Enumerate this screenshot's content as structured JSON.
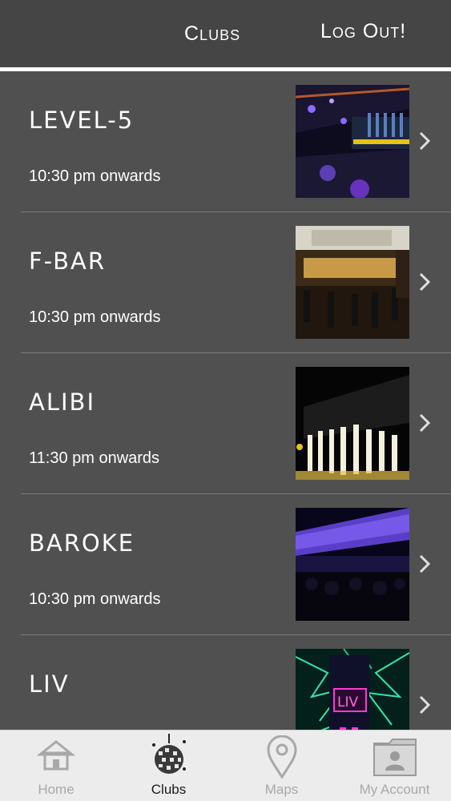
{
  "header": {
    "title": "Clubs",
    "logout_label": "Log Out!"
  },
  "clubs": [
    {
      "name": "LEVEL-5",
      "time": "10:30 pm onwards",
      "image": "club-interior-purple-lights"
    },
    {
      "name": "F-BAR",
      "time": "10:30 pm onwards",
      "image": "bar-interior-stools"
    },
    {
      "name": "ALIBI",
      "time": "11:30 pm onwards",
      "image": "illuminated-bottles-wall"
    },
    {
      "name": "BAROKE",
      "time": "10:30 pm onwards",
      "image": "purple-led-ceiling"
    },
    {
      "name": "LIV",
      "time": "",
      "image": "green-neon-liv-sign"
    }
  ],
  "tabs": [
    {
      "label": "Home",
      "icon": "home-icon",
      "active": false
    },
    {
      "label": "Clubs",
      "icon": "disco-ball-icon",
      "active": true
    },
    {
      "label": "Maps",
      "icon": "map-pin-icon",
      "active": false
    },
    {
      "label": "My Account",
      "icon": "account-folder-icon",
      "active": false
    }
  ],
  "colors": {
    "background": "#505050",
    "header": "#454545",
    "tabbar": "#ececec",
    "tab_inactive": "#a8a8a8"
  }
}
